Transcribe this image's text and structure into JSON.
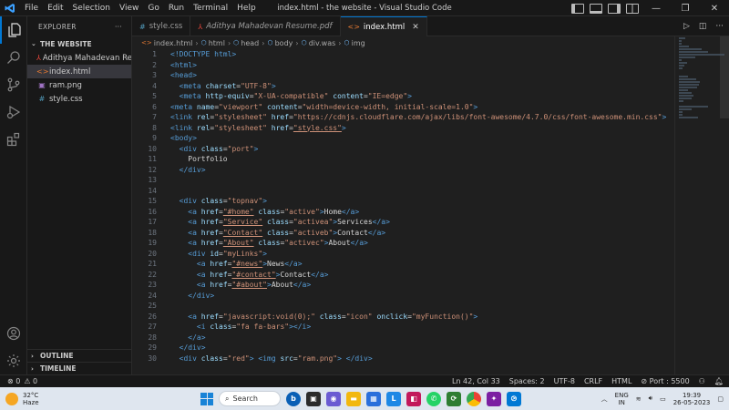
{
  "titlebar": {
    "menu": [
      "File",
      "Edit",
      "Selection",
      "View",
      "Go",
      "Run",
      "Terminal",
      "Help"
    ],
    "window_title": "index.html - the website - Visual Studio Code"
  },
  "sidebar": {
    "header": "EXPLORER",
    "more": "···",
    "folder": "THE WEBSITE",
    "files": [
      {
        "name": "Adithya Mahadevan Re...",
        "icon": "pdf-icon",
        "color": "#e8463b"
      },
      {
        "name": "index.html",
        "icon": "html-icon",
        "color": "#e37933"
      },
      {
        "name": "ram.png",
        "icon": "image-icon",
        "color": "#a074c4"
      },
      {
        "name": "style.css",
        "icon": "css-icon",
        "color": "#519aba"
      }
    ],
    "outline": "OUTLINE",
    "timeline": "TIMELINE"
  },
  "tabs": [
    {
      "label": "style.css",
      "icon": "#",
      "color": "#519aba"
    },
    {
      "label": "Adithya Mahadevan Resume.pdf",
      "icon": "⅄",
      "color": "#e8463b"
    },
    {
      "label": "index.html",
      "icon": "<>",
      "color": "#e37933",
      "close": "✕"
    }
  ],
  "breadcrumb": [
    "index.html",
    "html",
    "head",
    "body",
    "div.was",
    "img"
  ],
  "editor": {
    "lines": [
      {
        "n": "1",
        "code": "<!DOCTYPE html>"
      },
      {
        "n": "2",
        "code": "<html>"
      },
      {
        "n": "3",
        "code": "<head>"
      },
      {
        "n": "4",
        "code": "  <meta charset=\"UTF-8\">"
      },
      {
        "n": "5",
        "code": "  <meta http-equiv=\"X-UA-compatible\" content=\"IE=edge\">"
      },
      {
        "n": "6",
        "code": "<meta name=\"viewport\" content=\"width=device-width, initial-scale=1.0\">"
      },
      {
        "n": "7",
        "code": "<link rel=\"stylesheet\" href=\"https://cdnjs.cloudflare.com/ajax/libs/font-awesome/4.7.0/css/font-awesome.min.css\">"
      },
      {
        "n": "8",
        "code": "<link rel=\"stylesheet\" href=\"style.css\">"
      },
      {
        "n": "9",
        "code": "<body>"
      },
      {
        "n": "10",
        "code": "  <div class=\"port\">"
      },
      {
        "n": "11",
        "code": "    Portfolio"
      },
      {
        "n": "12",
        "code": "  </div>"
      },
      {
        "n": "13",
        "code": ""
      },
      {
        "n": "14",
        "code": ""
      },
      {
        "n": "15",
        "code": "  <div class=\"topnav\">"
      },
      {
        "n": "16",
        "code": "    <a href=\"#home\" class=\"active\">Home</a>"
      },
      {
        "n": "17",
        "code": "    <a href=\"Service\" class=\"activea\">Services</a>"
      },
      {
        "n": "18",
        "code": "    <a href=\"Contact\" class=\"activeb\">Contact</a>"
      },
      {
        "n": "19",
        "code": "    <a href=\"About\" class=\"activec\">About</a>"
      },
      {
        "n": "20",
        "code": "    <div id=\"myLinks\">"
      },
      {
        "n": "21",
        "code": "      <a href=\"#news\">News</a>"
      },
      {
        "n": "22",
        "code": "      <a href=\"#contact\">Contact</a>"
      },
      {
        "n": "23",
        "code": "      <a href=\"#about\">About</a>"
      },
      {
        "n": "24",
        "code": "    </div>"
      },
      {
        "n": "25",
        "code": ""
      },
      {
        "n": "26",
        "code": "    <a href=\"javascript:void(0);\" class=\"icon\" onclick=\"myFunction()\">"
      },
      {
        "n": "27",
        "code": "      <i class=\"fa fa-bars\"></i>"
      },
      {
        "n": "28",
        "code": "    </a>"
      },
      {
        "n": "29",
        "code": "  </div>"
      },
      {
        "n": "30",
        "code": "  <div class=\"red\"> <img src=\"ram.png\"> </div>"
      }
    ]
  },
  "statusbar": {
    "errors": "⊗ 0",
    "warnings": "⚠ 0",
    "position": "Ln 42, Col 33",
    "spaces": "Spaces: 2",
    "encoding": "UTF-8",
    "eol": "CRLF",
    "language": "HTML",
    "port": "Port : 5500"
  },
  "taskbar": {
    "temperature": "32°C",
    "weather": "Haze",
    "search_placeholder": "Search",
    "lang_line1": "ENG",
    "lang_line2": "IN",
    "time": "19:39",
    "date": "26-05-2023"
  }
}
